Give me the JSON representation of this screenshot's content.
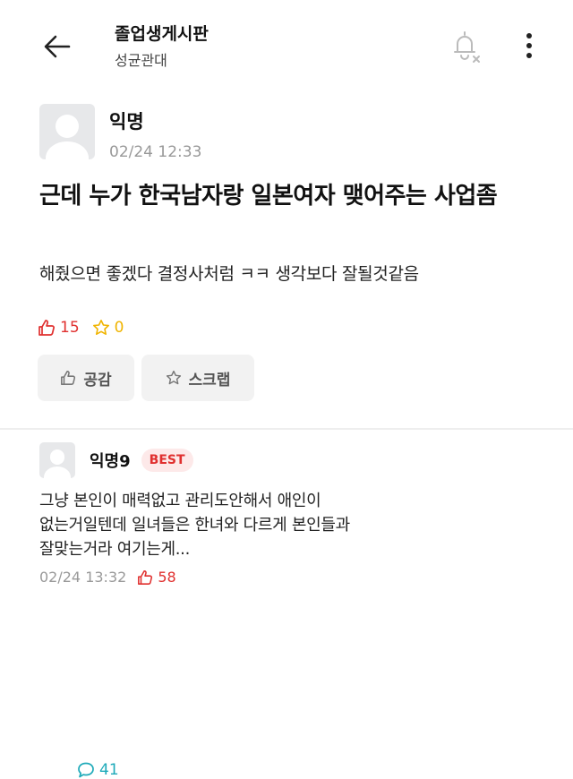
{
  "header": {
    "title": "졸업생게시판",
    "subtitle": "성균관대"
  },
  "post": {
    "author": "익명",
    "time": "02/24 12:33",
    "title": "근데 누가 한국남자랑 일본여자 맺어주는 사업좀",
    "body": "해줬으면 좋겠다 결정사처럼 ㅋㅋ 생각보다 잘될것같음",
    "stats": {
      "likes": "15",
      "comments": "41",
      "scraps": "0"
    },
    "actions": {
      "like_label": "공감",
      "scrap_label": "스크랩"
    }
  },
  "comments": [
    {
      "author": "익명9",
      "badge": "BEST",
      "body_line1": "그냥 본인이 매력없고 관리도안해서 애인이",
      "body_line2": "없는거일텐데 일녀들은 한녀와 다르게 본인들과",
      "body_line3": "잘맞는거라 여기는게...",
      "time": "02/24 13:32",
      "likes": "58"
    }
  ],
  "colors": {
    "accent_red": "#e0302f",
    "comment_teal": "#1eaab9",
    "scrap_yellow": "#f0b400"
  },
  "icons": {
    "back": "arrow-left-icon",
    "notify": "bell-off-icon",
    "more": "more-vertical-icon",
    "like": "thumbs-up-icon",
    "comment": "speech-bubble-icon",
    "scrap": "star-icon"
  }
}
